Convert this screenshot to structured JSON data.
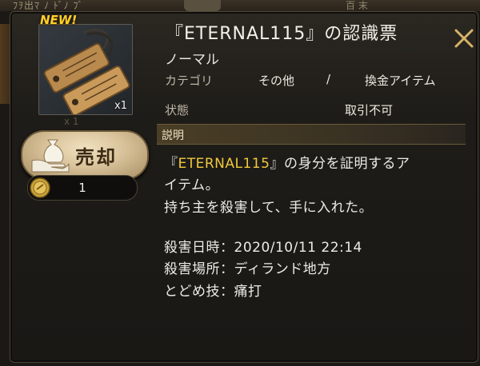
{
  "background": {
    "top_left_text": "ﾌｦ出ﾏ ﾉ ﾄﾞﾉ ﾌﾞ",
    "top_right_text": "百 末"
  },
  "item": {
    "new_badge": "NEW!",
    "quantity": "x1",
    "ghost_quantity": "x 1",
    "icon": "dog-tags-icon",
    "title": "『ETERNAL115』の認識票",
    "rarity": "ノーマル"
  },
  "sell": {
    "label": "売却",
    "icon": "hand-money-bag-icon",
    "price": "1",
    "coin_icon": "gold-coin-icon"
  },
  "details": {
    "category_label": "カテゴリ",
    "category_value": "その他",
    "category_sep": "/",
    "category_sub": "換金アイテム",
    "state_label": "状態",
    "state_value": "取引不可"
  },
  "description": {
    "header": "説明",
    "line1_pre": "『",
    "line1_name": "ETERNAL115",
    "line1_post": "』の身分を証明するア",
    "line2": "イテム。",
    "line3": "持ち主を殺害して、手に入れた。",
    "line4": "殺害日時：2020/10/11 22:14",
    "line5": "殺害場所：ディランド地方",
    "line6": "とどめ技：痛打"
  },
  "colors": {
    "accent_gold": "#f0c83a",
    "panel_bg": "#1e1c18"
  }
}
